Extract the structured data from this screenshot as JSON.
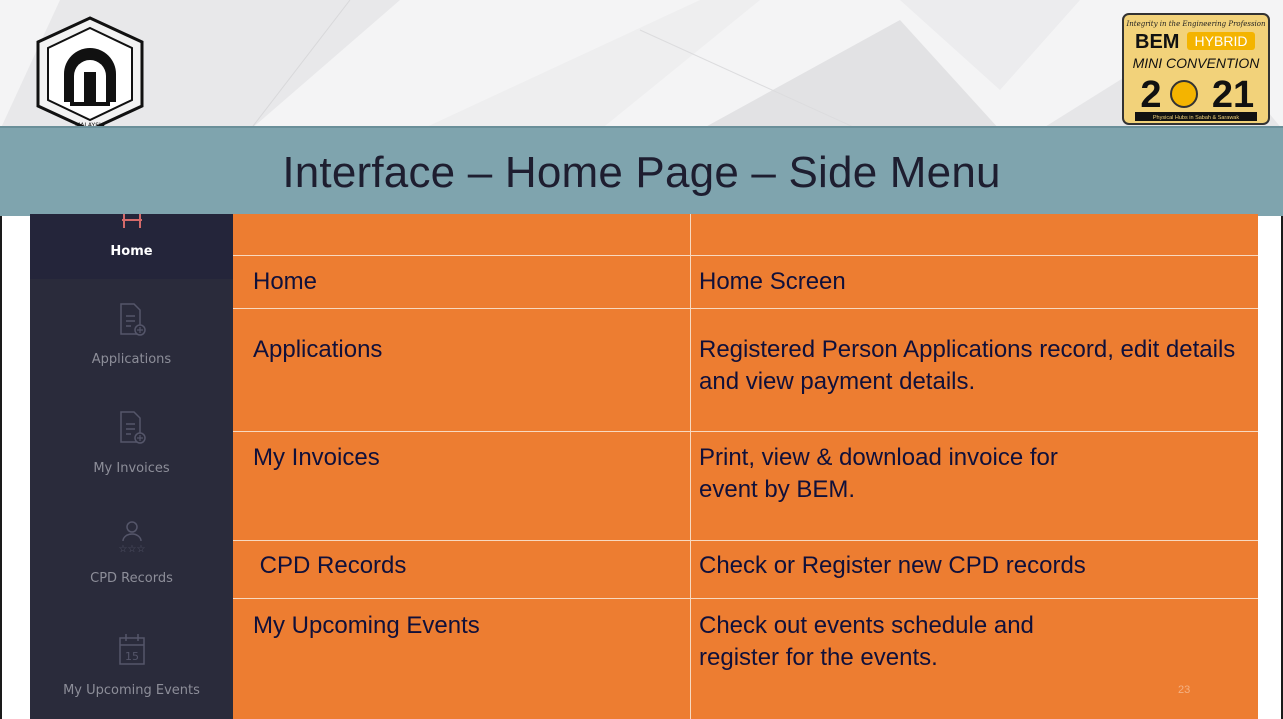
{
  "slide": {
    "title": "Interface – Home Page – Side Menu",
    "page_number": "23"
  },
  "logos": {
    "left": {
      "text": "LEMBAGA JURUTERA MALAYSIA"
    },
    "right": {
      "tagline": "Integrity in the Engineering Profession",
      "brand": "BEM",
      "badge": "HYBRID",
      "subtitle": "MINI CONVENTION",
      "year": "2021",
      "footer": "Physical Hubs in Sabah & Sarawak"
    }
  },
  "sidebar": {
    "items": [
      {
        "label": "Home",
        "icon": "home-icon",
        "active": true
      },
      {
        "label": "Applications",
        "icon": "document-plus-icon",
        "active": false
      },
      {
        "label": "My Invoices",
        "icon": "document-plus-icon",
        "active": false
      },
      {
        "label": "CPD Records",
        "icon": "user-stars-icon",
        "active": false
      },
      {
        "label": "My Upcoming Events",
        "icon": "calendar-icon",
        "active": false
      }
    ]
  },
  "table": {
    "rows": [
      {
        "menu": "Home",
        "description": "Home Screen"
      },
      {
        "menu": "Applications",
        "description": "Registered Person Applications record, edit details and view payment details."
      },
      {
        "menu": "My Invoices",
        "description": "Print, view & download invoice for event by BEM."
      },
      {
        "menu": " CPD Records",
        "description": "Check or Register new CPD records"
      },
      {
        "menu": "My Upcoming Events",
        "description": "Check out events schedule and register for the events."
      }
    ]
  },
  "colors": {
    "title_band": "#7fa4ae",
    "table_fill": "#ed7d31",
    "sidebar_bg": "#2a2b3b",
    "text_dark": "#10103a"
  }
}
